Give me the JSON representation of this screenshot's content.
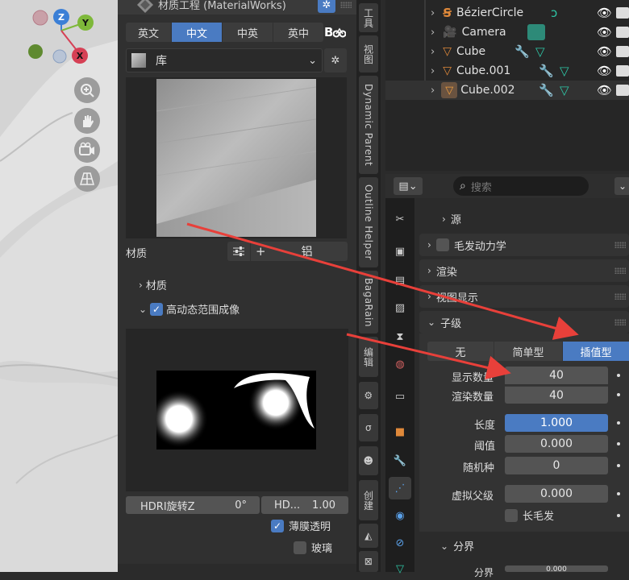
{
  "panel": {
    "title": "材质工程 (MaterialWorks)",
    "lang_tabs": [
      "英文",
      "中文",
      "中英",
      "英中"
    ],
    "lang_selected": 1,
    "library_label": "库",
    "material_label": "材质",
    "material_add": "+",
    "material_value": "铝",
    "section_material": "材质",
    "section_hdri": "高动态范围成像",
    "hdri_rot_label": "HDRI旋转Z",
    "hdri_rot_value": "0°",
    "hd_label": "HD...",
    "hd_value": "1.00",
    "thin_film_label": "薄膜透明",
    "glass_label": "玻璃"
  },
  "vertical_tabs": [
    "工具",
    "视图",
    "Dynamic Parent",
    "Outline Helper",
    "BagaRain",
    "编辑",
    "创建"
  ],
  "outliner": {
    "rows": [
      {
        "name": "BézierCircle",
        "icon": "curve-icon"
      },
      {
        "name": "Camera",
        "icon": "camera-icon"
      },
      {
        "name": "Cube",
        "icon": "mesh-icon"
      },
      {
        "name": "Cube.001",
        "icon": "mesh-icon"
      },
      {
        "name": "Cube.002",
        "icon": "mesh-icon"
      }
    ]
  },
  "properties": {
    "search_placeholder": "搜索",
    "sec_source": "源",
    "sec_hair_dynamics": "毛发动力学",
    "sec_render": "渲染",
    "sec_viewport_display": "视图显示",
    "sec_children": "子级",
    "child_modes": [
      "无",
      "简单型",
      "插值型"
    ],
    "child_mode_selected": 2,
    "display_amount_label": "显示数量",
    "display_amount_value": "40",
    "render_amount_label": "渲染数量",
    "render_amount_value": "40",
    "length_label": "长度",
    "length_value": "1.000",
    "threshold_label": "阈值",
    "threshold_value": "0.000",
    "seed_label": "随机种",
    "seed_value": "0",
    "virtual_parents_label": "虚拟父级",
    "virtual_parents_value": "0.000",
    "long_hair_label": "长毛发",
    "sec_clumping": "分界",
    "clump_label": "分界",
    "clump_value": "0.000"
  },
  "colors": {
    "accent": "#4a7bc2",
    "annotation_arrow": "#e8403a"
  }
}
